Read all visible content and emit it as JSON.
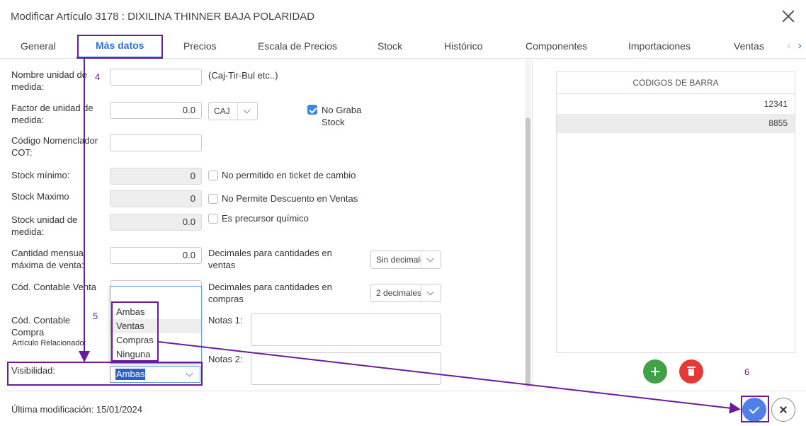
{
  "window": {
    "title": "Modificar Artículo 3178 : DIXILINA THINNER BAJA POLARIDAD"
  },
  "tabs": [
    {
      "label": "General"
    },
    {
      "label": "Más datos"
    },
    {
      "label": "Precios"
    },
    {
      "label": "Escala de Precios"
    },
    {
      "label": "Stock"
    },
    {
      "label": "Histórico"
    },
    {
      "label": "Componentes"
    },
    {
      "label": "Importaciones"
    },
    {
      "label": "Ventas"
    }
  ],
  "tab_arrows": {
    "prev": "‹",
    "next": "›"
  },
  "form": {
    "nombre_unidad": {
      "label": "Nombre unidad de medida:",
      "value": "",
      "hint": "(Caj-Tir-Bul etc..)"
    },
    "factor_unidad": {
      "label": "Factor de unidad de medida:",
      "value": "0.0",
      "unit": "CAJ"
    },
    "no_graba_stock": {
      "label": "No Graba Stock",
      "checked": true
    },
    "codigo_nomenclador": {
      "label": "Código Nomenclador COT:",
      "value": ""
    },
    "stock_minimo": {
      "label": "Stock mínimo:",
      "value": "0"
    },
    "no_permitido_ticket": {
      "label": "No permitido en ticket de cambio",
      "checked": false
    },
    "stock_maximo": {
      "label": "Stock Maximo",
      "value": "0"
    },
    "no_permite_descuento": {
      "label": "No Permite Descuento en Ventas",
      "checked": false
    },
    "stock_unidad": {
      "label": "Stock unidad de medida:",
      "value": "0.0"
    },
    "precursor": {
      "label": "Es precursor químico",
      "checked": false
    },
    "cantidad_mensual": {
      "label": "Cantidad mensual máxima de venta:",
      "value": "0.0"
    },
    "decimales_ventas": {
      "label": "Decimales para cantidades en ventas",
      "value": "Sin decimales"
    },
    "cod_contable_venta": {
      "label": "Cód. Contable Venta"
    },
    "decimales_compras": {
      "label": "Decimales para cantidades en compras",
      "value": "2 decimales"
    },
    "cod_contable_compra": {
      "label": "Cód. Contable Compra"
    },
    "articulo_relacionado": {
      "label": "Artículo Relacionado:"
    },
    "notas1": {
      "label": "Notas 1:"
    },
    "notas2": {
      "label": "Notas 2:"
    },
    "visibilidad": {
      "label": "Visibilidad:",
      "value": "Ambas",
      "options": [
        "Ambas",
        "Ventas",
        "Compras",
        "Ninguna"
      ],
      "highlighted": "Ventas"
    }
  },
  "barcodes": {
    "header": "CÓDIGOS DE BARRA",
    "rows": [
      "12341",
      "8855"
    ]
  },
  "footer": {
    "last_modified": "Última modificación: 15/01/2024"
  },
  "annotations": {
    "step4": "4",
    "step5": "5",
    "step6": "6",
    "color": "#6a1b9a"
  },
  "colors": {
    "accent": "#2d74d6",
    "add": "#43a047",
    "delete": "#e53935",
    "confirm": "#4f7fe8"
  },
  "icons": {
    "close": "close-icon",
    "add": "plus-icon",
    "delete": "trash-icon",
    "confirm": "check-icon",
    "cancel": "close-icon"
  }
}
